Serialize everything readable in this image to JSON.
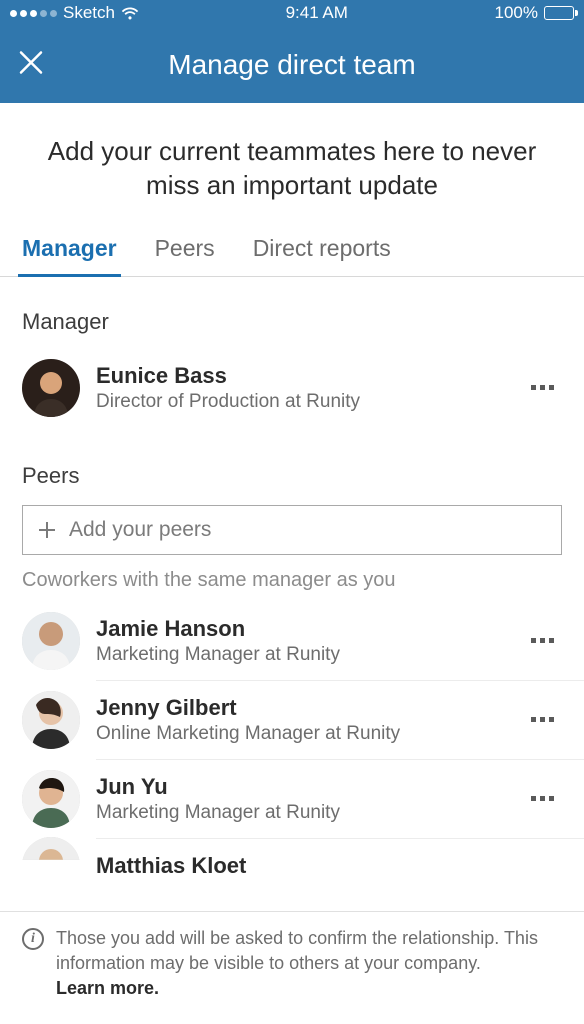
{
  "status_bar": {
    "carrier": "Sketch",
    "time": "9:41 AM",
    "battery_pct": "100%"
  },
  "header": {
    "title": "Manage direct team"
  },
  "intro": "Add your current teammates here to never miss an important update",
  "tabs": [
    {
      "label": "Manager",
      "active": true
    },
    {
      "label": "Peers",
      "active": false
    },
    {
      "label": "Direct reports",
      "active": false
    }
  ],
  "sections": {
    "manager": {
      "label": "Manager",
      "person": {
        "name": "Eunice Bass",
        "title": "Director of Production at Runity"
      }
    },
    "peers": {
      "label": "Peers",
      "add_placeholder": "Add your peers",
      "subtext": "Coworkers with the same manager as you",
      "people": [
        {
          "name": "Jamie Hanson",
          "title": "Marketing Manager at Runity"
        },
        {
          "name": "Jenny Gilbert",
          "title": "Online Marketing Manager at Runity"
        },
        {
          "name": "Jun Yu",
          "title": "Marketing Manager at Runity"
        },
        {
          "name": "Matthias Kloet",
          "title": ""
        }
      ]
    }
  },
  "footer": {
    "line1": "Those you add will be asked to confirm the relationship.",
    "line2": "This information may be visible to others at your company.",
    "learn_more": "Learn more."
  },
  "colors": {
    "brand": "#3077ad",
    "accent": "#1b6fb0"
  }
}
